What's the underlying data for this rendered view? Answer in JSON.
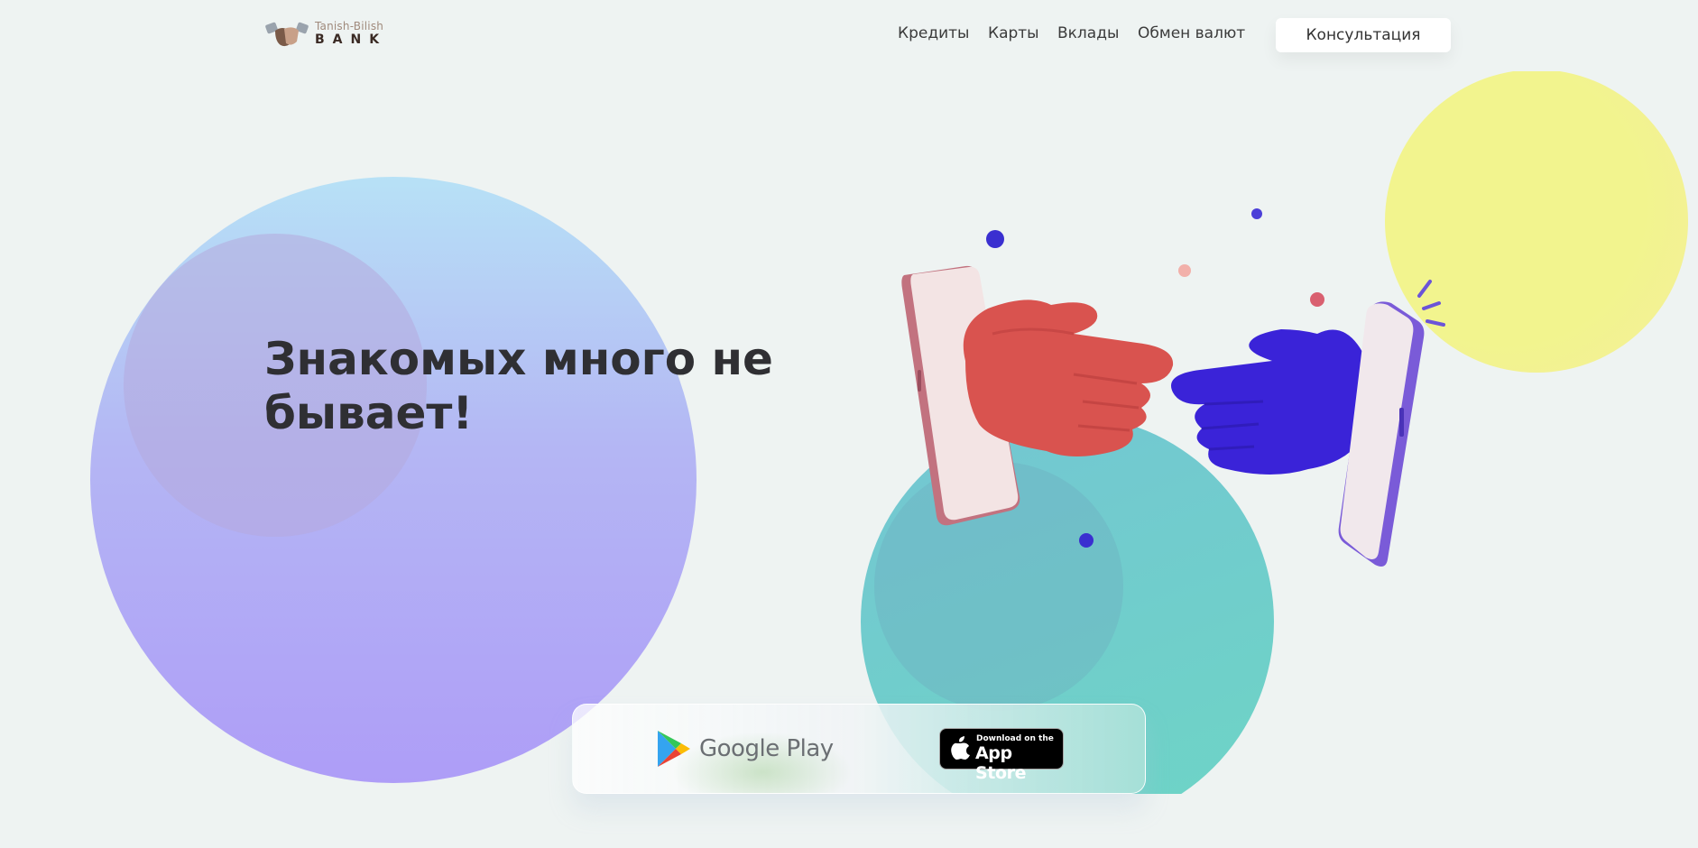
{
  "brand": {
    "line1": "Tanish-Bilish",
    "line2": "BANK"
  },
  "nav": {
    "items": [
      {
        "label": "Кредиты"
      },
      {
        "label": "Карты"
      },
      {
        "label": "Вклады"
      },
      {
        "label": "Обмен валют"
      }
    ],
    "cta": "Консультация"
  },
  "hero": {
    "title_line1": "Знакомых много не",
    "title_line2": "бывает!"
  },
  "stores": {
    "google_play": "Google Play",
    "app_store_small": "Download on the",
    "app_store_big": "App Store"
  },
  "colors": {
    "background": "#eef3f2",
    "text": "#2f2f33",
    "red_hand": "#d9534f",
    "blue_hand": "#3a23d8",
    "yellow": "#f2f48e",
    "teal": "#6fd0c9",
    "lavender": "#ae9df7"
  },
  "icons": [
    "handshake-logo-icon",
    "google-play-icon",
    "apple-icon"
  ]
}
